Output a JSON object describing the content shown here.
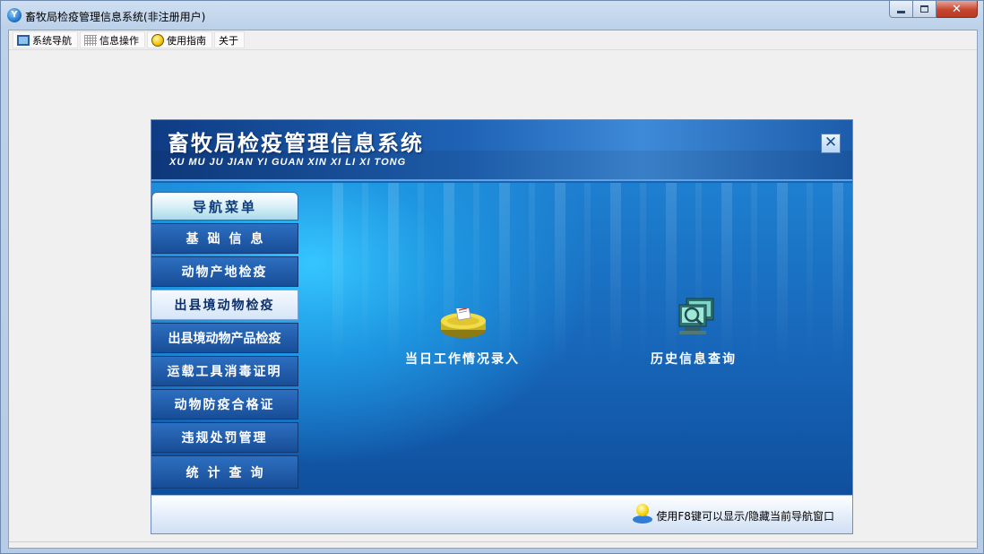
{
  "window": {
    "title": "畜牧局检疫管理信息系统(非注册用户)"
  },
  "menubar": {
    "items": [
      {
        "label": "系统导航",
        "icon": "screen-icon"
      },
      {
        "label": "信息操作",
        "icon": "grid-icon"
      },
      {
        "label": "使用指南",
        "icon": "bulb-icon"
      },
      {
        "label": "关于",
        "icon": ""
      }
    ]
  },
  "panel": {
    "title": "畜牧局检疫管理信息系统",
    "subtitle": "XU MU JU JIAN YI GUAN  XIN XI LI XI TONG",
    "close_glyph": "✕",
    "nav": {
      "header": "导航菜单",
      "items": [
        {
          "label": "基础信息",
          "active": false
        },
        {
          "label": "动物产地检疫",
          "active": false
        },
        {
          "label": "出县境动物检疫",
          "active": true
        },
        {
          "label": "出县境动物产品检疫",
          "active": false
        },
        {
          "label": "运载工具消毒证明",
          "active": false
        },
        {
          "label": "动物防疫合格证",
          "active": false
        },
        {
          "label": "违规处罚管理",
          "active": false
        },
        {
          "label": "统计查询",
          "active": false
        }
      ]
    },
    "actions": {
      "daily_entry": {
        "label": "当日工作情况录入",
        "icon": "database-entry-icon"
      },
      "history": {
        "label": "历史信息查询",
        "icon": "monitor-search-icon"
      }
    },
    "hint": "使用F8键可以显示/隐藏当前导航窗口"
  },
  "colors": {
    "accent_blue": "#1b62b4",
    "nav_item": "#184d97",
    "nav_active": "#d6e5f7",
    "close_red": "#c8452f"
  }
}
